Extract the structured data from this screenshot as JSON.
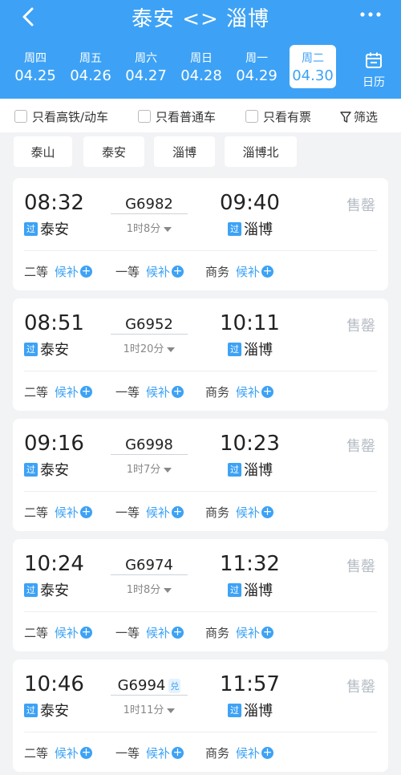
{
  "header": {
    "back_icon": "chevron-left-icon",
    "title": "泰安 <> 淄博",
    "more_icon": "more-dots-icon"
  },
  "dates": [
    {
      "weekday": "周四",
      "date": "04.25",
      "active": false
    },
    {
      "weekday": "周五",
      "date": "04.26",
      "active": false
    },
    {
      "weekday": "周六",
      "date": "04.27",
      "active": false
    },
    {
      "weekday": "周日",
      "date": "04.28",
      "active": false
    },
    {
      "weekday": "周一",
      "date": "04.29",
      "active": false
    },
    {
      "weekday": "周二",
      "date": "04.30",
      "active": true
    }
  ],
  "calendar": {
    "label": "日历",
    "icon": "calendar-icon"
  },
  "filters": {
    "high_speed": "只看高铁/动车",
    "normal": "只看普通车",
    "available": "只看有票",
    "filter_btn": "筛选",
    "filter_icon": "funnel-icon"
  },
  "stations": [
    "泰山",
    "泰安",
    "淄博",
    "淄博北"
  ],
  "trains": [
    {
      "dep_time": "08:32",
      "arr_time": "09:40",
      "train_no": "G6982",
      "badge": "",
      "duration": "1时8分",
      "from": "泰安",
      "to": "淄博",
      "pass_tag": "过",
      "status": "售罄"
    },
    {
      "dep_time": "08:51",
      "arr_time": "10:11",
      "train_no": "G6952",
      "badge": "",
      "duration": "1时20分",
      "from": "泰安",
      "to": "淄博",
      "pass_tag": "过",
      "status": "售罄"
    },
    {
      "dep_time": "09:16",
      "arr_time": "10:23",
      "train_no": "G6998",
      "badge": "",
      "duration": "1时7分",
      "from": "泰安",
      "to": "淄博",
      "pass_tag": "过",
      "status": "售罄"
    },
    {
      "dep_time": "10:24",
      "arr_time": "11:32",
      "train_no": "G6974",
      "badge": "",
      "duration": "1时8分",
      "from": "泰安",
      "to": "淄博",
      "pass_tag": "过",
      "status": "售罄"
    },
    {
      "dep_time": "10:46",
      "arr_time": "11:57",
      "train_no": "G6994",
      "badge": "兑",
      "duration": "1时11分",
      "from": "泰安",
      "to": "淄博",
      "pass_tag": "过",
      "status": "售罄"
    }
  ],
  "seats": {
    "second": "二等",
    "first": "一等",
    "business": "商务",
    "waitlist": "候补"
  },
  "colors": {
    "accent": "#3da2f5",
    "background": "#f2f3f5",
    "sold_out": "#b6bcc4"
  }
}
